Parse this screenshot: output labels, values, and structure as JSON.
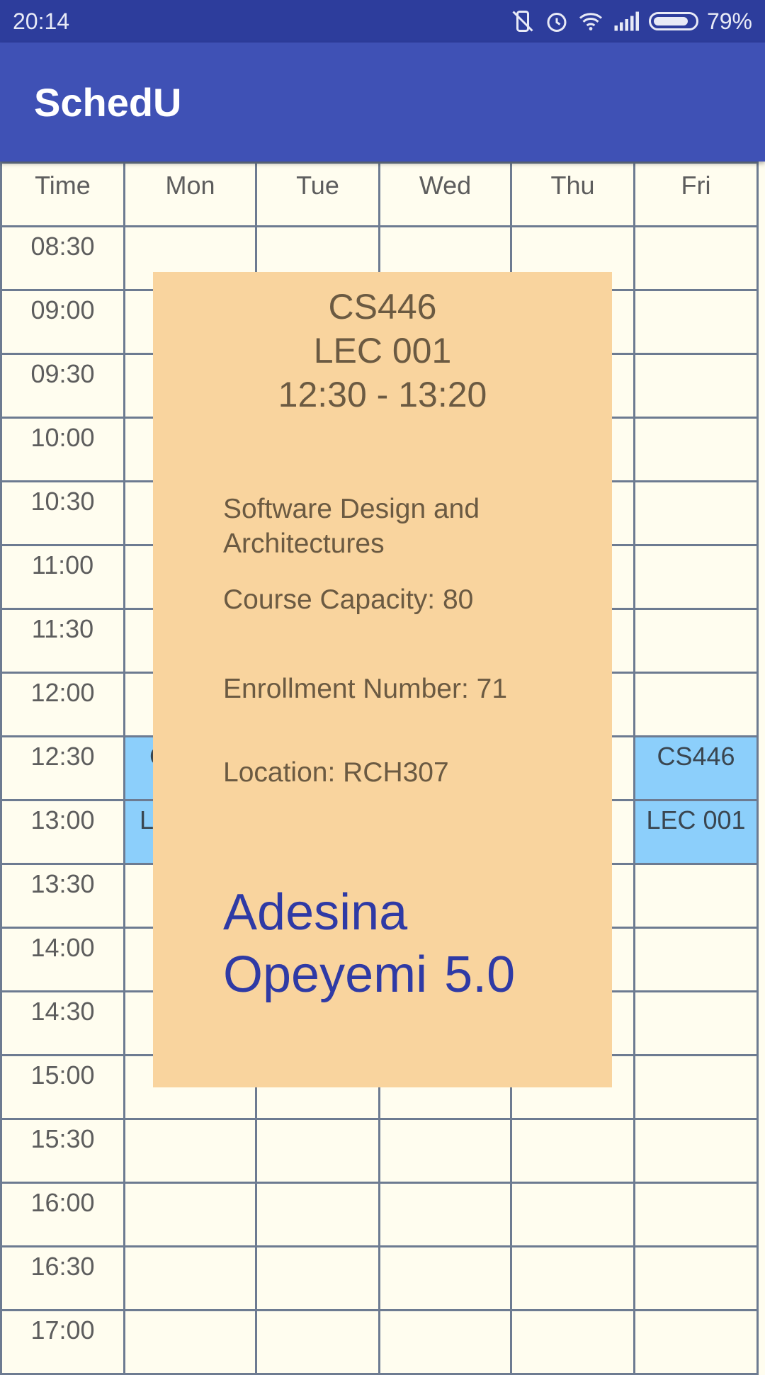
{
  "status_bar": {
    "time": "20:14",
    "battery_percent": "79%",
    "battery_level": 0.79,
    "icons": [
      "vibrate-off-icon",
      "alarm-icon",
      "wifi-icon",
      "signal-icon",
      "battery-icon"
    ]
  },
  "app_bar": {
    "title": "SchedU"
  },
  "timetable": {
    "headers": [
      "Time",
      "Mon",
      "Tue",
      "Wed",
      "Thu",
      "Fri"
    ],
    "times": [
      "08:30",
      "09:00",
      "09:30",
      "10:00",
      "10:30",
      "11:00",
      "11:30",
      "12:00",
      "12:30",
      "13:00",
      "13:30",
      "14:00",
      "14:30",
      "15:00",
      "15:30",
      "16:00",
      "16:30",
      "17:00"
    ],
    "mon_partial": [
      "C",
      "L"
    ],
    "fri_course": {
      "code": "CS446",
      "section": "LEC 001"
    }
  },
  "popup": {
    "code": "CS446",
    "section": "LEC 001",
    "time_range": "12:30 - 13:20",
    "title": "Software Design and Architectures",
    "capacity": "Course Capacity: 80",
    "enrollment": "Enrollment Number: 71",
    "location": "Location: RCH307",
    "professor": "Adesina Opeyemi",
    "rating": "5.0"
  },
  "colors": {
    "status_bar": "#2d3d9c",
    "app_bar": "#3f51b5",
    "grid_bg": "#fffdef",
    "grid_line": "#6d7b91",
    "course_cell": "#8ccffb",
    "popup_bg": "#f9d49e",
    "professor_text": "#2f3aa5"
  }
}
